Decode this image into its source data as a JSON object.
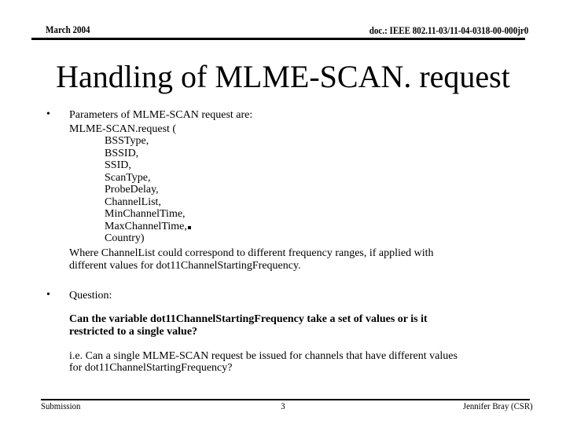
{
  "header": {
    "date": "March 2004",
    "doc_id": "doc.: IEEE 802.11-03/11-04-0318-00-000jr0"
  },
  "title": "Handling of MLME-SCAN. request",
  "bullets": [
    {
      "symbol": "•",
      "intro": "Parameters of MLME-SCAN request are:",
      "call_open": "MLME-SCAN.request (",
      "params": [
        "BSSType,",
        "BSSID,",
        "SSID,",
        "ScanType,",
        "ProbeDelay,",
        "ChannelList,",
        "MinChannelTime,",
        "MaxChannelTime,",
        "Country)"
      ],
      "note_line1": "Where ChannelList could correspond to different frequency ranges, if applied with",
      "note_line2": "different values for  dot11ChannelStartingFrequency."
    },
    {
      "symbol": "•",
      "label": "Question:",
      "question_line1": "Can the variable dot11ChannelStartingFrequency take a set of values or is it",
      "question_line2": "restricted to a single value?",
      "ie_line1": "i.e. Can a single MLME-SCAN request be issued for channels that have different values",
      "ie_line2": "for dot11ChannelStartingFrequency?"
    }
  ],
  "footer": {
    "left": "Submission",
    "page": "3",
    "author": "Jennifer Bray (CSR)"
  }
}
